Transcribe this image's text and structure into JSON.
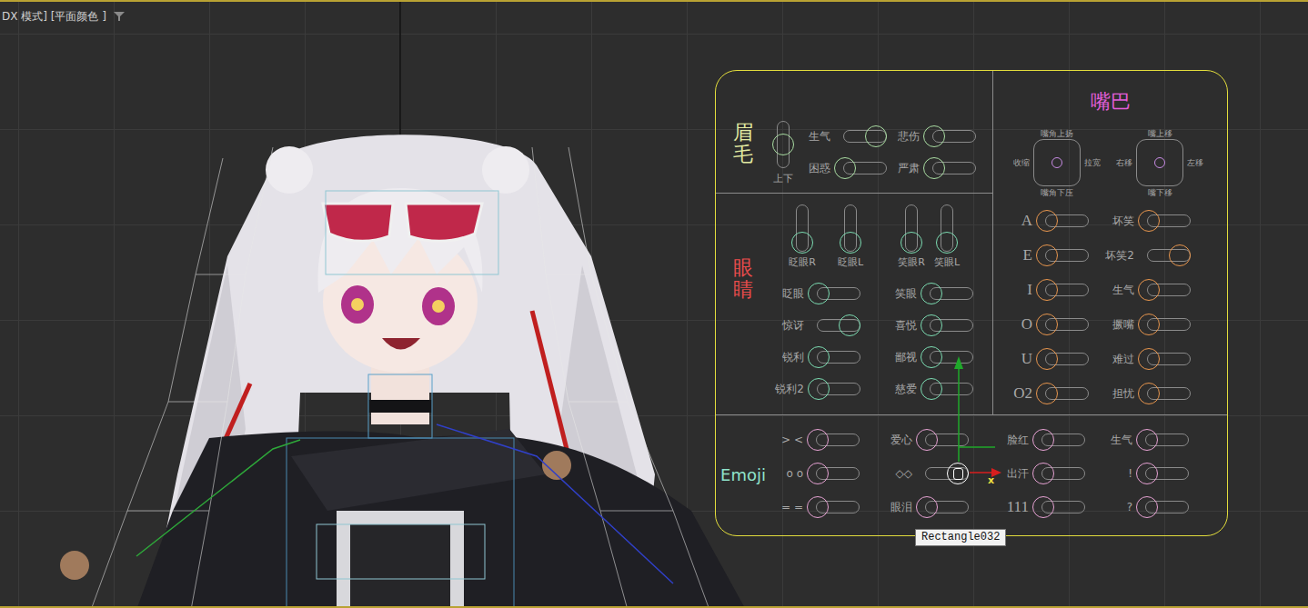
{
  "viewport": {
    "mode_label": "DX 模式] [平面颜色 ]",
    "tooltip": "Rectangle032",
    "axis_label": "x"
  },
  "brows": {
    "title": "眉毛",
    "title_color": "#e2eaa2",
    "color": "#a9dca2",
    "vsliders": [
      {
        "label": "上下",
        "level": 0.5,
        "selected": false
      }
    ],
    "sliders": [
      {
        "label": "生气",
        "level": 1,
        "selected": false
      },
      {
        "label": "悲伤",
        "level": 0,
        "selected": false
      },
      {
        "label": "困惑",
        "level": 0,
        "selected": false
      },
      {
        "label": "严肃",
        "level": 0,
        "selected": false
      }
    ]
  },
  "eyes": {
    "title": "眼睛",
    "title_color": "#e84c4c",
    "color": "#7cdcb2",
    "vsliders": [
      {
        "label": "眨眼R",
        "level": 0,
        "selected": false
      },
      {
        "label": "眨眼L",
        "level": 0,
        "selected": false
      },
      {
        "label": "笑眼R",
        "level": 0,
        "selected": false
      },
      {
        "label": "笑眼L",
        "level": 0,
        "selected": false
      }
    ],
    "sliders": [
      {
        "label": "眨眼",
        "level": 0,
        "selected": false
      },
      {
        "label": "笑眼",
        "level": 0,
        "selected": false
      },
      {
        "label": "惊讶",
        "level": 1,
        "selected": false
      },
      {
        "label": "喜悦",
        "level": 0,
        "selected": false
      },
      {
        "label": "锐利",
        "level": 0,
        "selected": false
      },
      {
        "label": "鄙视",
        "level": 0,
        "selected": false
      },
      {
        "label": "锐利2",
        "level": 0,
        "selected": false
      },
      {
        "label": "慈爱",
        "level": 0,
        "selected": false
      }
    ]
  },
  "mouth": {
    "title": "嘴巴",
    "title_color": "#e15ed8",
    "color": "#e8964e",
    "pad_color": "#c68ae2",
    "pads": [
      {
        "top": "嘴角上扬",
        "bottom": "嘴角下压",
        "left": "收缩",
        "right": "拉宽",
        "level_x": 0.5,
        "level_y": 0.5,
        "selected": false
      },
      {
        "top": "嘴上移",
        "bottom": "嘴下移",
        "left": "右移",
        "right": "左移",
        "level_x": 0.5,
        "level_y": 0.5,
        "selected": false
      }
    ],
    "sliders": [
      {
        "label": "A",
        "kind": "letter",
        "level": 0,
        "selected": false
      },
      {
        "label": "坏笑",
        "kind": "word",
        "level": 0,
        "selected": false
      },
      {
        "label": "E",
        "kind": "letter",
        "level": 0,
        "selected": false
      },
      {
        "label": "坏笑2",
        "kind": "word",
        "level": 1,
        "selected": false
      },
      {
        "label": "I",
        "kind": "letter",
        "level": 0,
        "selected": false
      },
      {
        "label": "生气",
        "kind": "word",
        "level": 0,
        "selected": false
      },
      {
        "label": "O",
        "kind": "letter",
        "level": 0,
        "selected": false
      },
      {
        "label": "撅嘴",
        "kind": "word",
        "level": 0,
        "selected": false
      },
      {
        "label": "U",
        "kind": "letter",
        "level": 0,
        "selected": false
      },
      {
        "label": "难过",
        "kind": "word",
        "level": 0,
        "selected": false
      },
      {
        "label": "O2",
        "kind": "letter",
        "level": 0,
        "selected": false
      },
      {
        "label": "担忧",
        "kind": "word",
        "level": 0,
        "selected": false
      }
    ]
  },
  "emoji": {
    "title": "Emoji",
    "title_color": "#8fe3ca",
    "color": "#e6a2d3",
    "sliders": [
      {
        "label": "> <",
        "kind": "word",
        "level": 0,
        "selected": false
      },
      {
        "label": "爱心",
        "kind": "word",
        "level": 0,
        "selected": false
      },
      {
        "label": "脸红",
        "kind": "word",
        "level": 0,
        "selected": false
      },
      {
        "label": "生气",
        "kind": "word",
        "level": 0,
        "selected": false
      },
      {
        "label": "o o",
        "kind": "word",
        "level": 0,
        "selected": false
      },
      {
        "label": "◇◇",
        "kind": "word",
        "level": 1,
        "selected": true
      },
      {
        "label": "出汗",
        "kind": "word",
        "level": 0,
        "selected": false
      },
      {
        "label": "!",
        "kind": "word",
        "level": 0,
        "selected": false
      },
      {
        "label": "= =",
        "kind": "word",
        "level": 0,
        "selected": false
      },
      {
        "label": "眼泪",
        "kind": "word",
        "level": 0,
        "selected": false
      },
      {
        "label": "111",
        "kind": "letter",
        "level": 0,
        "selected": false
      },
      {
        "label": "?",
        "kind": "word",
        "level": 0,
        "selected": false
      }
    ]
  }
}
